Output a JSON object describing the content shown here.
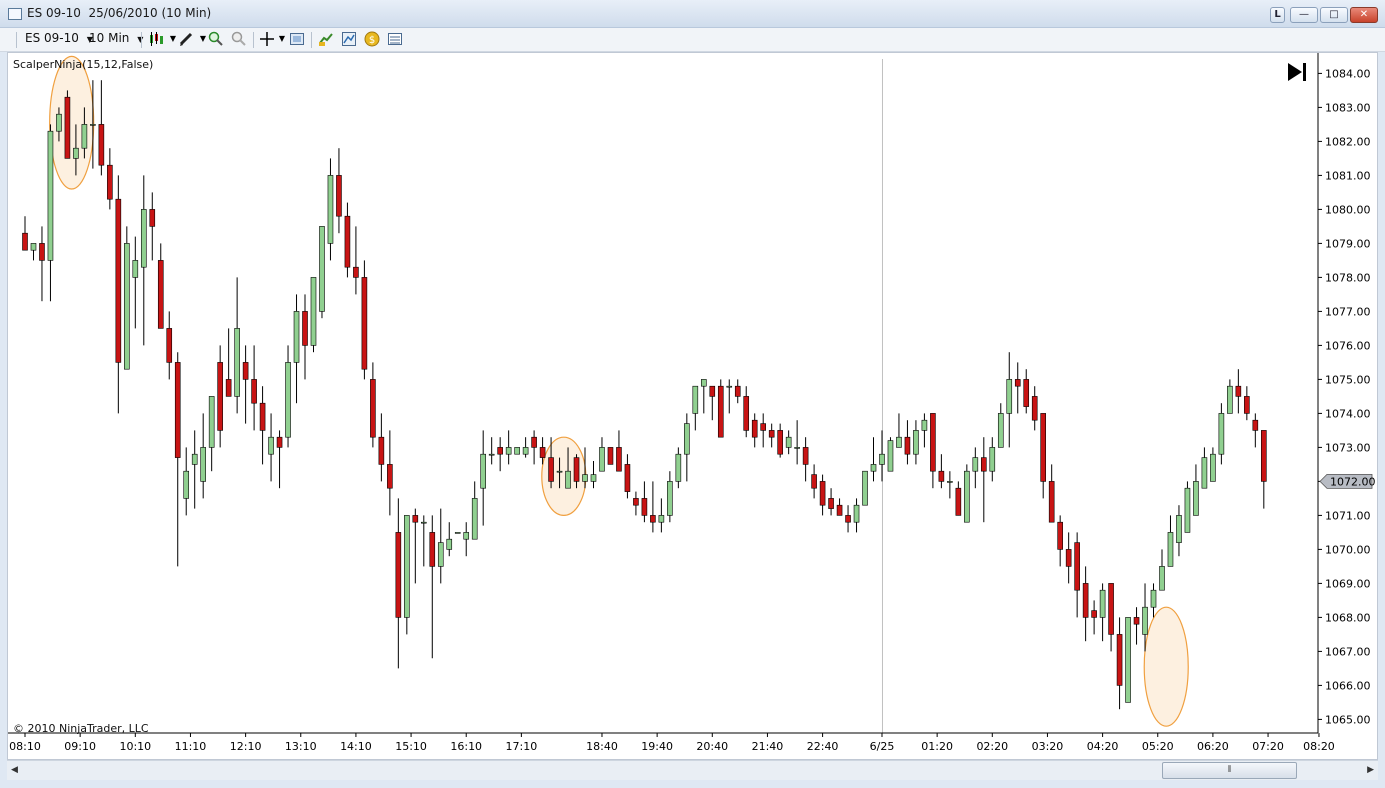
{
  "window": {
    "title": "ES 09-10  25/06/2010 (10 Min)",
    "btn_l": "L",
    "btn_min": "—",
    "btn_max": "□",
    "btn_close": "✕"
  },
  "toolbar": {
    "instrument": "ES 09-10",
    "period": "10 Min",
    "icons": [
      "candlestick-icon",
      "pencil-icon",
      "zoom-in-icon",
      "zoom-out-icon",
      "crosshair-icon",
      "properties-icon",
      "instrument-icon",
      "indicator-icon",
      "strategy-icon",
      "data-box-icon"
    ]
  },
  "chart": {
    "indicator_label": "ScalperNinja(15,12,False)",
    "copyright": "© 2010 NinjaTrader, LLC",
    "current_price": "1072.00",
    "colors": {
      "up": "#90d090",
      "down": "#c81414",
      "wick": "#000000",
      "highlight_fill": "#fbe3c7",
      "highlight_stroke": "#f0a040"
    }
  },
  "chart_data": {
    "type": "candlestick",
    "ylim": [
      1064.6,
      1084.6
    ],
    "y_ticks": [
      "1084.00",
      "1083.00",
      "1082.00",
      "1081.00",
      "1080.00",
      "1079.00",
      "1078.00",
      "1077.00",
      "1076.00",
      "1075.00",
      "1074.00",
      "1073.00",
      "1072.00",
      "1071.00",
      "1070.00",
      "1069.00",
      "1068.00",
      "1067.00",
      "1066.00",
      "1065.00"
    ],
    "x_ticks": [
      "08:10",
      "09:10",
      "10:10",
      "11:10",
      "12:10",
      "13:10",
      "14:10",
      "15:10",
      "16:10",
      "17:10",
      "18:40",
      "19:40",
      "20:40",
      "21:40",
      "22:40",
      "6/25",
      "01:20",
      "02:20",
      "03:20",
      "04:20",
      "05:20",
      "06:20",
      "07:20",
      "08:20"
    ],
    "bars": [
      [
        1079.3,
        1079.8,
        1078.8,
        1078.8
      ],
      [
        1078.8,
        1079.0,
        1078.5,
        1079.0
      ],
      [
        1079.0,
        1079.5,
        1077.3,
        1078.5
      ],
      [
        1078.5,
        1082.5,
        1077.3,
        1082.3
      ],
      [
        1082.3,
        1083.0,
        1082.0,
        1082.8
      ],
      [
        1083.3,
        1083.5,
        1081.5,
        1081.5
      ],
      [
        1081.5,
        1082.5,
        1081.0,
        1081.8
      ],
      [
        1081.8,
        1083.0,
        1081.5,
        1082.5
      ],
      [
        1082.5,
        1083.8,
        1081.2,
        1082.5
      ],
      [
        1082.5,
        1083.8,
        1081.0,
        1081.3
      ],
      [
        1081.3,
        1081.8,
        1080.0,
        1080.3
      ],
      [
        1080.3,
        1081.0,
        1074.0,
        1075.5
      ],
      [
        1075.3,
        1079.5,
        1075.3,
        1079.0
      ],
      [
        1078.0,
        1079.2,
        1076.5,
        1078.5
      ],
      [
        1078.3,
        1081.0,
        1076.0,
        1080.0
      ],
      [
        1080.0,
        1080.5,
        1078.5,
        1079.5
      ],
      [
        1078.5,
        1079.0,
        1076.5,
        1076.5
      ],
      [
        1076.5,
        1077.0,
        1075.0,
        1075.5
      ],
      [
        1075.5,
        1075.8,
        1069.5,
        1072.7
      ],
      [
        1071.5,
        1073.0,
        1071.0,
        1072.3
      ],
      [
        1072.5,
        1073.5,
        1071.2,
        1072.8
      ],
      [
        1072.0,
        1074.0,
        1071.5,
        1073.0
      ],
      [
        1073.0,
        1074.5,
        1072.3,
        1074.5
      ],
      [
        1075.5,
        1076.0,
        1073.0,
        1073.5
      ],
      [
        1075.0,
        1076.5,
        1074.5,
        1074.5
      ],
      [
        1074.5,
        1078.0,
        1074.0,
        1076.5
      ],
      [
        1075.5,
        1076.0,
        1073.7,
        1075.0
      ],
      [
        1075.0,
        1076.0,
        1073.5,
        1074.3
      ],
      [
        1074.3,
        1074.8,
        1072.5,
        1073.5
      ],
      [
        1072.8,
        1074.0,
        1072.0,
        1073.3
      ],
      [
        1073.3,
        1073.5,
        1071.8,
        1073.0
      ],
      [
        1073.3,
        1076.0,
        1073.0,
        1075.5
      ],
      [
        1075.5,
        1077.5,
        1074.3,
        1077.0
      ],
      [
        1077.0,
        1077.5,
        1075.0,
        1076.0
      ],
      [
        1076.0,
        1078.0,
        1075.8,
        1078.0
      ],
      [
        1077.0,
        1079.5,
        1076.8,
        1079.5
      ],
      [
        1079.0,
        1081.5,
        1078.5,
        1081.0
      ],
      [
        1081.0,
        1081.8,
        1079.3,
        1079.8
      ],
      [
        1079.8,
        1080.2,
        1078.0,
        1078.3
      ],
      [
        1078.3,
        1079.5,
        1077.5,
        1078.0
      ],
      [
        1078.0,
        1078.5,
        1075.0,
        1075.3
      ],
      [
        1075.0,
        1075.5,
        1073.0,
        1073.3
      ],
      [
        1073.3,
        1074.0,
        1072.0,
        1072.5
      ],
      [
        1072.5,
        1073.5,
        1071.0,
        1071.8
      ],
      [
        1070.5,
        1071.5,
        1066.5,
        1068.0
      ],
      [
        1068.0,
        1071.0,
        1067.5,
        1071.0
      ],
      [
        1071.0,
        1071.2,
        1069.0,
        1070.8
      ],
      [
        1070.8,
        1071.0,
        1069.5,
        1070.8
      ],
      [
        1070.5,
        1071.0,
        1066.8,
        1069.5
      ],
      [
        1069.5,
        1071.2,
        1069.0,
        1070.2
      ],
      [
        1070.0,
        1070.8,
        1069.8,
        1070.3
      ],
      [
        1070.5,
        1070.5,
        1070.5,
        1070.5
      ],
      [
        1070.3,
        1070.8,
        1069.8,
        1070.5
      ],
      [
        1070.3,
        1072.0,
        1070.3,
        1071.5
      ],
      [
        1071.8,
        1073.5,
        1070.7,
        1072.8
      ],
      [
        1072.8,
        1073.3,
        1072.5,
        1072.8
      ],
      [
        1073.0,
        1073.3,
        1072.3,
        1072.8
      ],
      [
        1072.8,
        1073.5,
        1072.5,
        1073.0
      ],
      [
        1072.8,
        1073.0,
        1072.8,
        1073.0
      ],
      [
        1072.8,
        1073.3,
        1072.7,
        1073.0
      ],
      [
        1073.3,
        1073.5,
        1072.5,
        1073.0
      ],
      [
        1073.0,
        1073.3,
        1072.5,
        1072.7
      ],
      [
        1072.7,
        1073.3,
        1071.8,
        1072.0
      ],
      [
        1072.3,
        1072.7,
        1071.8,
        1072.3
      ],
      [
        1071.8,
        1073.0,
        1071.8,
        1072.3
      ],
      [
        1072.7,
        1072.8,
        1071.8,
        1072.0
      ],
      [
        1072.0,
        1073.0,
        1071.8,
        1072.2
      ],
      [
        1072.0,
        1072.6,
        1071.8,
        1072.2
      ],
      [
        1072.3,
        1073.3,
        1072.3,
        1073.0
      ],
      [
        1073.0,
        1073.0,
        1072.5,
        1072.5
      ],
      [
        1073.0,
        1073.5,
        1072.3,
        1072.3
      ],
      [
        1072.5,
        1072.8,
        1071.5,
        1071.7
      ],
      [
        1071.5,
        1071.7,
        1071.0,
        1071.3
      ],
      [
        1071.5,
        1072.0,
        1070.8,
        1071.0
      ],
      [
        1071.0,
        1072.0,
        1070.5,
        1070.8
      ],
      [
        1070.8,
        1071.5,
        1070.5,
        1071.0
      ],
      [
        1071.0,
        1072.3,
        1070.8,
        1072.0
      ],
      [
        1072.0,
        1073.0,
        1071.8,
        1072.8
      ],
      [
        1072.8,
        1074.0,
        1072.0,
        1073.7
      ],
      [
        1074.0,
        1074.8,
        1073.5,
        1074.8
      ],
      [
        1074.8,
        1075.0,
        1074.0,
        1075.0
      ],
      [
        1074.8,
        1074.8,
        1073.8,
        1074.5
      ],
      [
        1074.8,
        1075.0,
        1073.5,
        1073.3
      ],
      [
        1074.8,
        1075.0,
        1074.0,
        1074.8
      ],
      [
        1074.8,
        1075.0,
        1074.3,
        1074.5
      ],
      [
        1074.5,
        1074.8,
        1073.3,
        1073.5
      ],
      [
        1073.8,
        1074.0,
        1073.0,
        1073.3
      ],
      [
        1073.7,
        1074.0,
        1073.0,
        1073.5
      ],
      [
        1073.5,
        1073.7,
        1073.0,
        1073.3
      ],
      [
        1073.5,
        1073.7,
        1072.7,
        1072.8
      ],
      [
        1073.0,
        1073.5,
        1072.8,
        1073.3
      ],
      [
        1073.0,
        1073.8,
        1072.5,
        1073.0
      ],
      [
        1073.0,
        1073.3,
        1072.0,
        1072.5
      ],
      [
        1072.2,
        1072.5,
        1071.5,
        1071.8
      ],
      [
        1072.0,
        1072.2,
        1071.0,
        1071.3
      ],
      [
        1071.5,
        1071.8,
        1071.0,
        1071.2
      ],
      [
        1071.3,
        1071.5,
        1071.0,
        1071.0
      ],
      [
        1071.0,
        1071.3,
        1070.5,
        1070.8
      ],
      [
        1070.8,
        1071.5,
        1070.5,
        1071.3
      ],
      [
        1071.3,
        1072.3,
        1071.3,
        1072.3
      ],
      [
        1072.3,
        1073.3,
        1072.0,
        1072.5
      ],
      [
        1072.5,
        1073.5,
        1072.0,
        1072.8
      ],
      [
        1072.3,
        1073.3,
        1072.3,
        1073.2
      ],
      [
        1073.0,
        1074.0,
        1073.0,
        1073.3
      ],
      [
        1073.3,
        1073.8,
        1072.5,
        1072.8
      ],
      [
        1072.8,
        1073.8,
        1072.5,
        1073.5
      ],
      [
        1073.5,
        1074.0,
        1073.0,
        1073.8
      ],
      [
        1074.0,
        1074.0,
        1071.8,
        1072.3
      ],
      [
        1072.3,
        1072.8,
        1071.8,
        1072.0
      ],
      [
        1072.0,
        1072.3,
        1071.5,
        1072.0
      ],
      [
        1071.8,
        1072.0,
        1071.0,
        1071.0
      ],
      [
        1070.8,
        1072.5,
        1070.8,
        1072.3
      ],
      [
        1072.3,
        1073.0,
        1071.8,
        1072.7
      ],
      [
        1072.7,
        1073.3,
        1070.8,
        1072.3
      ],
      [
        1072.3,
        1073.3,
        1072.0,
        1073.0
      ],
      [
        1073.0,
        1074.3,
        1073.0,
        1074.0
      ],
      [
        1074.0,
        1075.8,
        1073.0,
        1075.0
      ],
      [
        1075.0,
        1075.5,
        1074.0,
        1074.8
      ],
      [
        1075.0,
        1075.3,
        1074.0,
        1074.2
      ],
      [
        1074.5,
        1074.8,
        1073.5,
        1073.8
      ],
      [
        1074.0,
        1074.0,
        1071.5,
        1072.0
      ],
      [
        1072.0,
        1072.5,
        1070.8,
        1070.8
      ],
      [
        1070.8,
        1071.0,
        1069.5,
        1070.0
      ],
      [
        1070.0,
        1070.5,
        1069.0,
        1069.5
      ],
      [
        1070.2,
        1070.5,
        1068.0,
        1068.8
      ],
      [
        1069.0,
        1069.5,
        1067.3,
        1068.0
      ],
      [
        1068.2,
        1068.5,
        1067.5,
        1068.0
      ],
      [
        1068.0,
        1069.0,
        1067.3,
        1068.8
      ],
      [
        1069.0,
        1069.0,
        1067.0,
        1067.5
      ],
      [
        1067.5,
        1068.0,
        1065.3,
        1066.0
      ],
      [
        1065.5,
        1068.0,
        1065.5,
        1068.0
      ],
      [
        1068.0,
        1068.3,
        1067.2,
        1067.8
      ],
      [
        1067.5,
        1069.0,
        1067.0,
        1068.3
      ],
      [
        1068.3,
        1069.0,
        1068.0,
        1068.8
      ],
      [
        1068.8,
        1070.0,
        1068.8,
        1069.5
      ],
      [
        1069.5,
        1071.0,
        1069.5,
        1070.5
      ],
      [
        1070.2,
        1071.3,
        1069.8,
        1071.0
      ],
      [
        1070.5,
        1072.0,
        1070.5,
        1071.8
      ],
      [
        1071.0,
        1072.5,
        1071.0,
        1072.0
      ],
      [
        1071.8,
        1073.0,
        1071.8,
        1072.7
      ],
      [
        1072.0,
        1073.0,
        1072.0,
        1072.8
      ],
      [
        1072.8,
        1074.3,
        1072.5,
        1074.0
      ],
      [
        1074.0,
        1075.0,
        1074.0,
        1074.8
      ],
      [
        1074.8,
        1075.3,
        1074.0,
        1074.5
      ],
      [
        1074.5,
        1074.8,
        1073.8,
        1074.0
      ],
      [
        1073.8,
        1074.0,
        1073.0,
        1073.5
      ],
      [
        1073.5,
        1073.5,
        1071.2,
        1072.0
      ]
    ],
    "vertical_line_index": 101,
    "highlights": [
      {
        "center_index": 5.5,
        "price_low": 1080.6,
        "price_high": 1084.5
      },
      {
        "center_index": 63.5,
        "price_low": 1071.0,
        "price_high": 1073.3
      },
      {
        "center_index": 134.5,
        "price_low": 1064.8,
        "price_high": 1068.3
      }
    ]
  }
}
